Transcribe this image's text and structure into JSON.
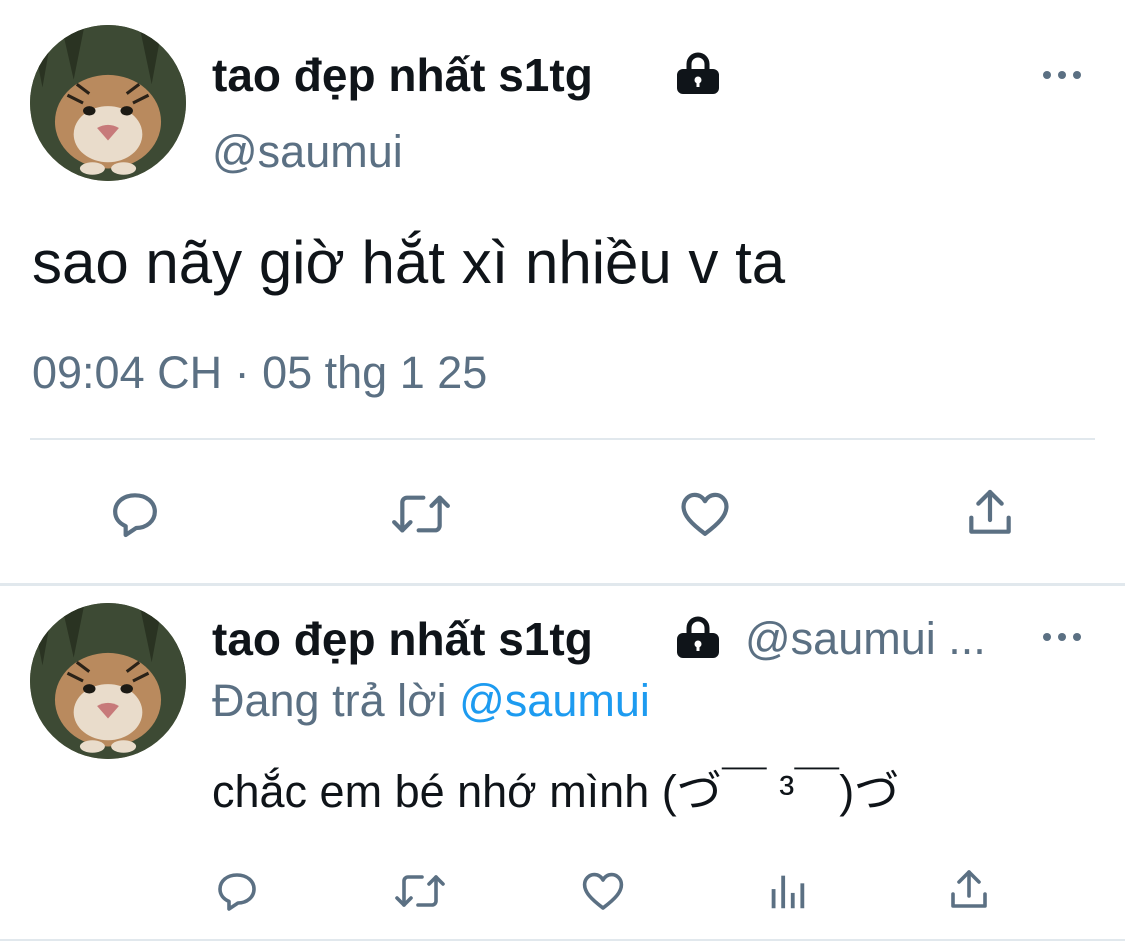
{
  "main_tweet": {
    "display_name": "tao đẹp nhất s1tg",
    "handle": "@saumui",
    "text": "sao nãy giờ hắt xì nhiều v ta",
    "timestamp": "09:04 CH · 05 thg 1 25",
    "icons": [
      "lock-icon",
      "more-icon",
      "reply-icon",
      "retweet-icon",
      "like-icon",
      "share-icon"
    ]
  },
  "reply_tweet": {
    "display_name": "tao đẹp nhất s1tg",
    "handle": "@saumui ...",
    "replying_prefix": "Đang trả lời",
    "replying_handle": "@saumui",
    "text": "chắc em bé nhớ mình (づ￣ ³￣)づ",
    "icons": [
      "lock-icon",
      "more-icon",
      "reply-icon",
      "retweet-icon",
      "like-icon",
      "analytics-icon",
      "share-icon"
    ]
  },
  "colors": {
    "text": "#0f1419",
    "muted": "#5b7083",
    "link": "#1d9bf0",
    "divider": "#e1e8ed"
  }
}
